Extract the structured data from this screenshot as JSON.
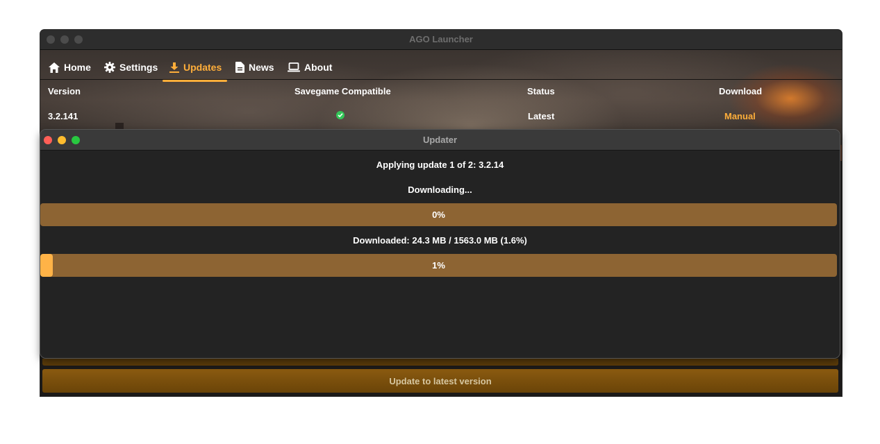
{
  "main_window": {
    "title": "AGO Launcher",
    "nav": {
      "tabs": [
        {
          "label": "Home",
          "icon": "home-icon",
          "active": false
        },
        {
          "label": "Settings",
          "icon": "gear-icon",
          "active": false
        },
        {
          "label": "Updates",
          "icon": "download-icon",
          "active": true
        },
        {
          "label": "News",
          "icon": "document-icon",
          "active": false
        },
        {
          "label": "About",
          "icon": "laptop-icon",
          "active": false
        }
      ]
    },
    "table": {
      "headers": {
        "version": "Version",
        "savegame": "Savegame Compatible",
        "status": "Status",
        "download": "Download"
      },
      "row": {
        "version": "3.2.141",
        "savegame_icon": "check-circle-icon",
        "status": "Latest",
        "download": "Manual"
      }
    },
    "update_button": "Update to latest version"
  },
  "updater_window": {
    "title": "Updater",
    "applying": "Applying update 1 of 2: 3.2.14",
    "state": "Downloading...",
    "overall_progress": {
      "label": "0%",
      "fraction": 0.0
    },
    "downloaded_text": "Downloaded: 24.3 MB / 1563.0 MB (1.6%)",
    "file_progress": {
      "label": "1%",
      "fraction": 0.016
    }
  },
  "colors": {
    "accent": "#ffae3a",
    "progress_track": "#8d6433",
    "progress_fill": "#ffb347",
    "close": "#ff5f57",
    "minimize": "#febc2e",
    "maximize": "#28c840",
    "check": "#34c759"
  }
}
